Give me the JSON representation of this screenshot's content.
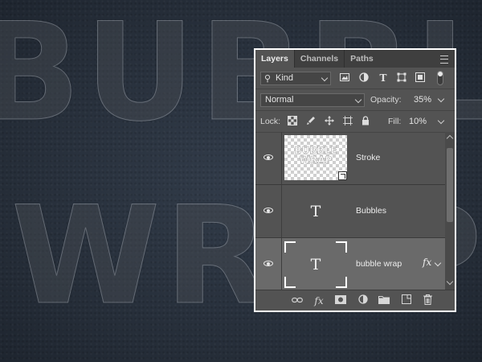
{
  "canvas": {
    "word_line1": "BUBBLE",
    "word_line2": "WRAP"
  },
  "panel": {
    "tabs": [
      {
        "label": "Layers"
      },
      {
        "label": "Channels"
      },
      {
        "label": "Paths"
      }
    ],
    "filter": {
      "kind_label": "Kind"
    },
    "blend_mode": "Normal",
    "opacity_label": "Opacity:",
    "opacity_value": "35%",
    "lock_label": "Lock:",
    "fill_label": "Fill:",
    "fill_value": "10%",
    "layers": [
      {
        "name": "Stroke",
        "thumb_line1": "BUBBLE",
        "thumb_line2": "WRAP"
      },
      {
        "name": "Bubbles",
        "type_glyph": "T"
      },
      {
        "name": "bubble wrap",
        "type_glyph": "T",
        "fx": "fx"
      }
    ]
  },
  "colors": {
    "panel_bg": "#535353",
    "selected_layer": "#6a6a6a",
    "panel_border": "#ffffff"
  }
}
